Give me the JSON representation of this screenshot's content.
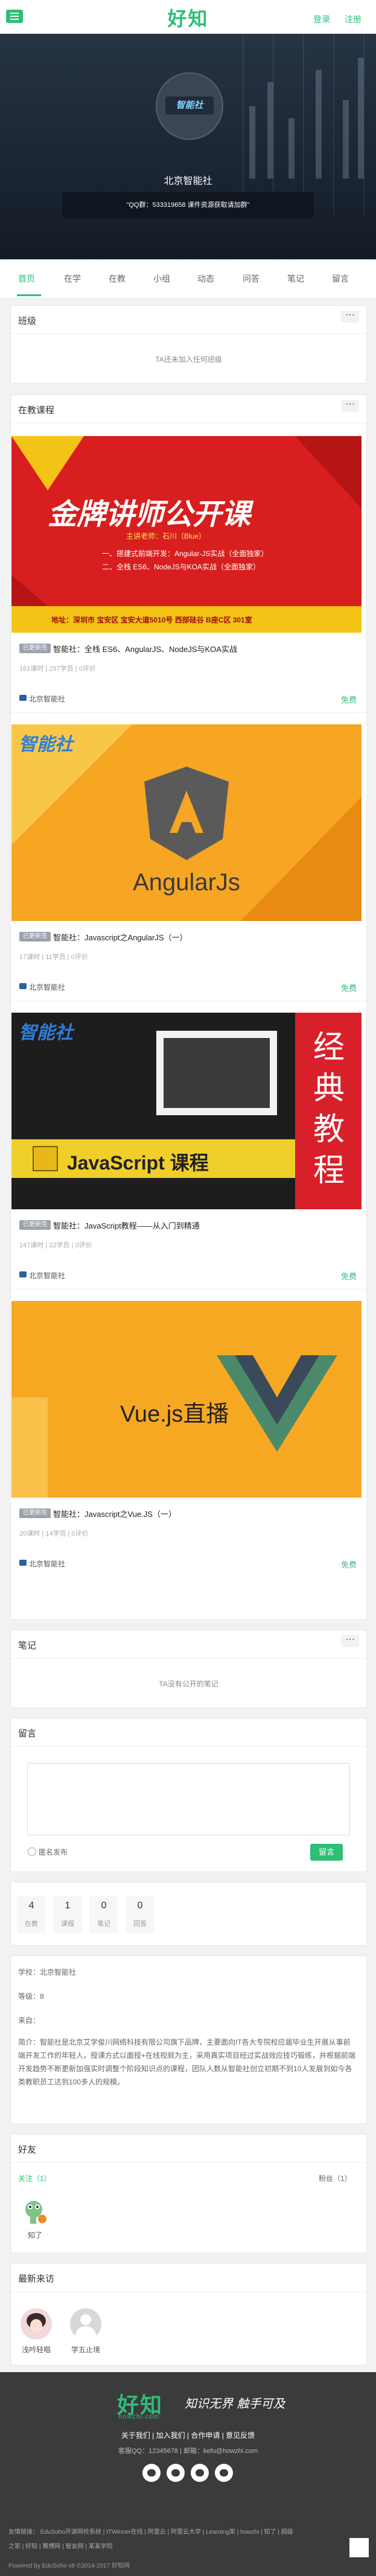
{
  "header": {
    "logo": "好知",
    "login_label": "登录",
    "register_label": "注册"
  },
  "profile": {
    "avatar_text": "智能社",
    "name": "北京智能社",
    "qq_notice": "\"QQ群：533319658 课件资源获取请加群\""
  },
  "tabs": [
    "首页",
    "在学",
    "在教",
    "小组",
    "动态",
    "问答",
    "笔记",
    "留言"
  ],
  "classes": {
    "title": "班级",
    "more": "⋯",
    "empty": "TA还未加入任何班级"
  },
  "teaching": {
    "title": "在教课程",
    "more": "⋯",
    "courses": [
      {
        "badge": "已更新完",
        "title": "智能社：全栈 ES6、AngularJS、NodeJS与KOA实战",
        "meta": "161课时  |  297学员  |  0评价",
        "org": "北京智能社",
        "price": "免费",
        "banner": {
          "headline": "金牌讲师公开课",
          "speaker": "主讲老师：石川（Blue）",
          "line1": "一、搭建式前端开发：Angular-JS实战（全面独家）",
          "line2": "二、全栈 ES6、NodeJS与KOA实战（全面独家）",
          "address": "地址：深圳市 宝安区 宝安大道5010号 西部硅谷 B座C区 301室"
        }
      },
      {
        "badge": "已更新完",
        "title": "智能社：Javascript之AngularJS（一）",
        "meta": "17课时  |  11学员  |  0评价",
        "org": "北京智能社",
        "price": "免费",
        "banner": {
          "logo": "智能社",
          "headline": "AngularJs"
        }
      },
      {
        "badge": "已更新完",
        "title": "智能社：JavaScript教程——从入门到精通",
        "meta": "147课时  |  22学员  |  0评价",
        "org": "北京智能社",
        "price": "免费",
        "banner": {
          "logo": "智能社",
          "headline": "JavaScript 课程",
          "side": "经典教程"
        }
      },
      {
        "badge": "已更新完",
        "title": "智能社：Javascript之Vue.JS（一）",
        "meta": "20课时  |  14学员  |  0评价",
        "org": "北京智能社",
        "price": "免费",
        "banner": {
          "headline": "Vue.js直播"
        }
      }
    ]
  },
  "notes": {
    "title": "笔记",
    "more": "⋯",
    "empty": "TA没有公开的笔记"
  },
  "messages": {
    "title": "留言",
    "anonymous_label": "匿名发布",
    "submit_label": "留言"
  },
  "stats": [
    {
      "num": "4",
      "label": "在教"
    },
    {
      "num": "1",
      "label": "课程"
    },
    {
      "num": "0",
      "label": "笔记"
    },
    {
      "num": "0",
      "label": "回答"
    }
  ],
  "info": {
    "school": "学校：北京智能社",
    "level": "等级：8",
    "from": "来自：",
    "intro": "简介：智能社是北京艾学俊川网络科技有限公司旗下品牌，主要面向IT各大专院校应届毕业生开展从事前端开发工作的年轻人，授课方式以面授+在线视频为主，采用真实项目经过实战效应技巧锻练，并根据前端开发趋势不断更新加强实时调整个阶段知识点的课程，团队人数从智能社创立初期不到10人发展到如今各类教职员工达到100多人的规模。"
  },
  "friends": {
    "title": "好友",
    "following": "关注（1）",
    "followers": "粉丝（1）",
    "list": [
      {
        "name": "知了"
      }
    ]
  },
  "visitors": {
    "title": "最新来访",
    "list": [
      {
        "name": "浅吟轻唱"
      },
      {
        "name": "学五止境"
      }
    ]
  },
  "footer": {
    "logo": "好知",
    "logo_sub": "howzhi.com",
    "slogan": "知识无界 触手可及",
    "nav": "关于我们  |  加入我们  |  合作申请  |  意见反馈",
    "contact": "客服QQ：12345678  |  邮箱：kefu@howzhi.com",
    "links_line1": "友情链接：   EduSoho开源网校系统  |  ITWinner在线  |  阿里云  |  阿里云大学  |  Learning家  |  howzhi  |  知了  |  超级",
    "links_line2": "之家  |  好知  |  赛博网  |  智友网  |  某某学院",
    "copyright": "Powered by EduSoho v8 ©2014-2017  好知网"
  },
  "colors": {
    "accent": "#2dbe78",
    "banner_bg": "#1b2533",
    "footer_bg": "#3b3b3b"
  }
}
